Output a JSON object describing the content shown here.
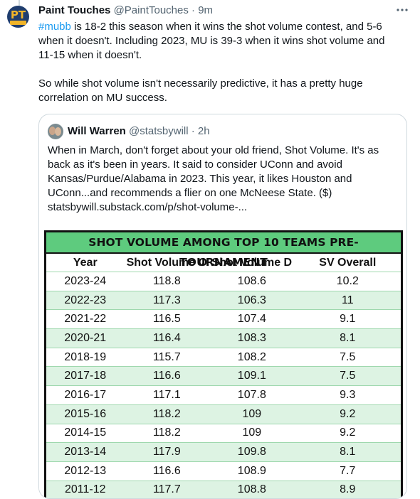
{
  "tweet": {
    "author_name": "Paint Touches",
    "author_meta": "@PaintTouches · 9m",
    "hashtag": "#mubb",
    "text_after_hashtag": " is 18-2 this season when it wins the shot volume contest, and 5-6 when it doesn't. Including 2023, MU is 39-3 when it wins shot volume and 11-15 when it doesn't.",
    "paragraph_2": "So while shot volume isn't necessarily predictive, it has a pretty huge correlation on MU success.",
    "avatar_text": "PT"
  },
  "quote": {
    "author_name": "Will Warren",
    "author_meta": "@statsbywill · 2h",
    "text": "When in March, don't forget about your old friend, Shot Volume. It's as back as it's been in years. It said to consider UConn and avoid Kansas/Purdue/Alabama in 2023. This year, it likes Houston and UConn...and recommends a flier on one McNeese State. ($) statsbywill.substack.com/p/shot-volume-..."
  },
  "table": {
    "title": "SHOT VOLUME AMONG TOP 10 TEAMS PRE-TOURNAMENT",
    "headers": [
      "Year",
      "Shot Volume O",
      "Shot Volume D",
      "SV Overall"
    ],
    "rows": [
      [
        "2023-24",
        "118.8",
        "108.6",
        "10.2"
      ],
      [
        "2022-23",
        "117.3",
        "106.3",
        "11"
      ],
      [
        "2021-22",
        "116.5",
        "107.4",
        "9.1"
      ],
      [
        "2020-21",
        "116.4",
        "108.3",
        "8.1"
      ],
      [
        "2018-19",
        "115.7",
        "108.2",
        "7.5"
      ],
      [
        "2017-18",
        "116.6",
        "109.1",
        "7.5"
      ],
      [
        "2016-17",
        "117.1",
        "107.8",
        "9.3"
      ],
      [
        "2015-16",
        "118.2",
        "109",
        "9.2"
      ],
      [
        "2014-15",
        "118.2",
        "109",
        "9.2"
      ],
      [
        "2013-14",
        "117.9",
        "109.8",
        "8.1"
      ],
      [
        "2012-13",
        "116.6",
        "108.9",
        "7.7"
      ],
      [
        "2011-12",
        "117.7",
        "108.8",
        "8.9"
      ]
    ]
  },
  "colors": {
    "link": "#1d9bf0",
    "title_band": "#5ecb7e",
    "stripe": "#ddf3e3",
    "muted": "#536471"
  },
  "icons": {
    "more": "more-horizontal-icon"
  }
}
